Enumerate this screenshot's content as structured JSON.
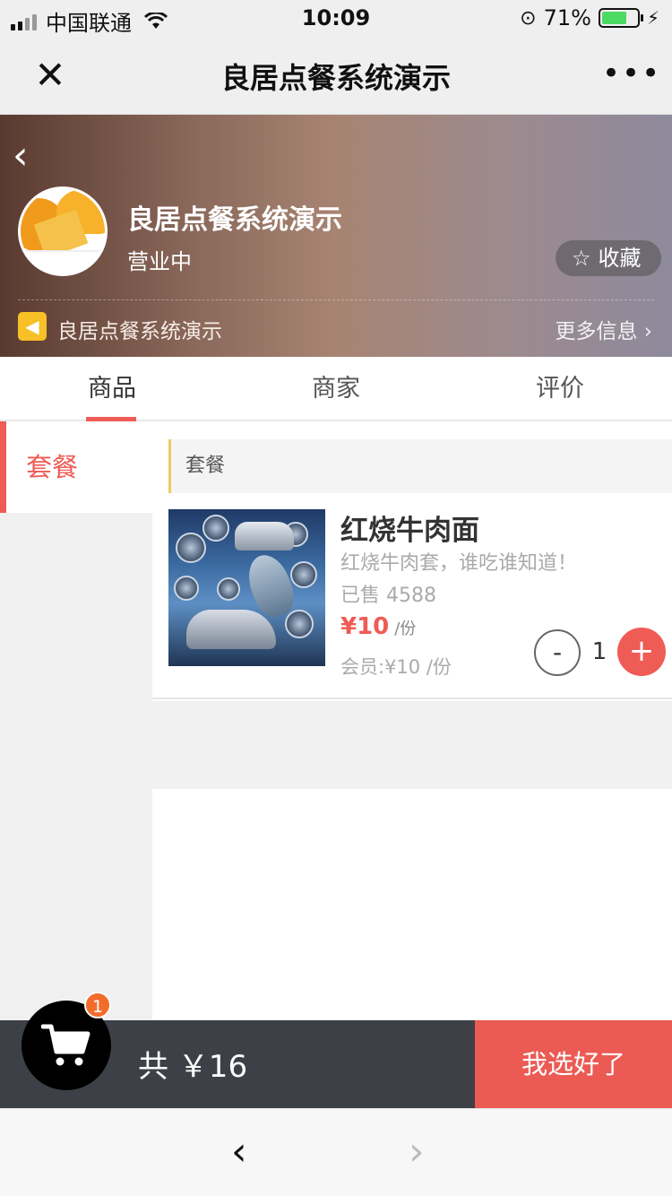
{
  "status_bar": {
    "carrier": "中国联通",
    "time": "10:09",
    "battery_percent": "71%",
    "battery_level": 0.71
  },
  "nav": {
    "title": "良居点餐系统演示",
    "close_icon": "close-icon",
    "more_icon": "more-icon"
  },
  "store": {
    "name": "良居点餐系统演示",
    "status": "营业中",
    "favorite_label": "收藏",
    "notice": "良居点餐系统演示",
    "more_info": "更多信息"
  },
  "tabs": [
    {
      "label": "商品",
      "active": true
    },
    {
      "label": "商家",
      "active": false
    },
    {
      "label": "评价",
      "active": false
    }
  ],
  "categories": [
    {
      "label": "套餐",
      "active": true
    }
  ],
  "section": {
    "title": "套餐"
  },
  "items": [
    {
      "name": "红烧牛肉面",
      "description": "红烧牛肉套，谁吃谁知道！",
      "sold": "已售 4588",
      "price": "¥10",
      "unit": "/份",
      "member_price": "会员:¥10 /份",
      "quantity": "1",
      "minus_label": "-",
      "plus_label": "+"
    }
  ],
  "cart": {
    "badge": "1",
    "total": "共 ￥16",
    "checkout_label": "我选好了"
  },
  "colors": {
    "accent": "#ef5b55",
    "cart_bar": "#3d4047",
    "badge": "#f36c2c",
    "notice_icon": "#f6c026"
  }
}
